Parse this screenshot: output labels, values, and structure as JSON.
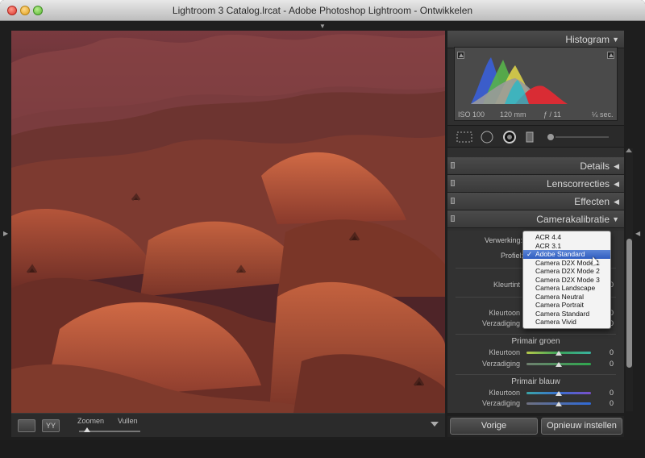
{
  "window": {
    "title": "Lightroom 3 Catalog.lrcat - Adobe Photoshop Lightroom - Ontwikkelen"
  },
  "icons": {
    "close": "close-icon",
    "minimize": "minimize-icon",
    "zoom": "zoom-icon",
    "edge_toggle": "triangle-icon"
  },
  "histogram": {
    "title": "Histogram",
    "iso": "ISO 100",
    "focal": "120 mm",
    "aperture": "ƒ / 11",
    "shutter": "¼ sec."
  },
  "panels": {
    "details": "Details",
    "lens": "Lenscorrecties",
    "effects": "Effecten",
    "calibration": "Camerakalibratie"
  },
  "calibration": {
    "process_label": "Verwerking:",
    "profile_label": "Profiel:",
    "tint_label": "Kleurtint",
    "red_hue_label": "Kleurtoon",
    "red_sat_label": "Verzadiging",
    "green_title": "Primair groen",
    "green_hue_label": "Kleurtoon",
    "green_hue_value": "0",
    "green_sat_label": "Verzadiging",
    "green_sat_value": "0",
    "blue_title": "Primair blauw",
    "blue_hue_label": "Kleurtoon",
    "blue_hue_value": "0",
    "blue_sat_label": "Verzadiging",
    "blue_sat_value": "0",
    "tint_value": "0",
    "red_hue_value": "0",
    "red_sat_value": "0"
  },
  "profile_menu": {
    "selected": "Adobe Standard",
    "items": [
      "ACR 4.4",
      "ACR 3.1",
      "Adobe Standard",
      "Camera D2X Mode 1",
      "Camera D2X Mode 2",
      "Camera D2X Mode 3",
      "Camera Landscape",
      "Camera Neutral",
      "Camera Portrait",
      "Camera Standard",
      "Camera Vivid"
    ],
    "check": "✓"
  },
  "toolbar": {
    "zoom_label": "Zoomen",
    "fill_label": "Vullen",
    "yy_label": "YY"
  },
  "buttons": {
    "previous": "Vorige",
    "reset": "Opnieuw instellen"
  },
  "colors": {
    "panel_bg": "#2f2f2f",
    "menu_highlight": "#3a67c8"
  }
}
